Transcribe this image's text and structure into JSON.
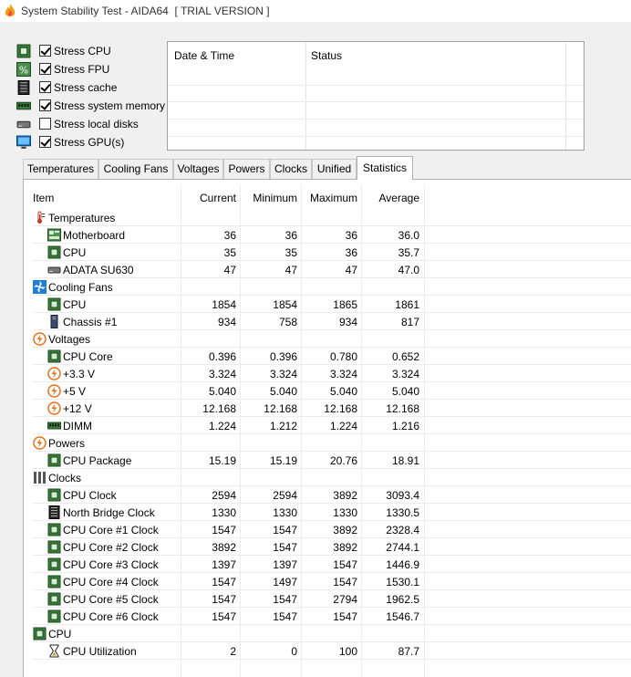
{
  "window": {
    "title": "System Stability Test - AIDA64  [ TRIAL VERSION ]"
  },
  "stress_options": [
    {
      "label": "Stress CPU",
      "checked": true,
      "icon": "cpu-chip-icon"
    },
    {
      "label": "Stress FPU",
      "checked": true,
      "icon": "fpu-icon"
    },
    {
      "label": "Stress cache",
      "checked": true,
      "icon": "cache-icon"
    },
    {
      "label": "Stress system memory",
      "checked": true,
      "icon": "memory-icon"
    },
    {
      "label": "Stress local disks",
      "checked": false,
      "icon": "disk-icon"
    },
    {
      "label": "Stress GPU(s)",
      "checked": true,
      "icon": "monitor-icon"
    }
  ],
  "log": {
    "col_datetime": "Date & Time",
    "col_status": "Status"
  },
  "tabs": [
    "Temperatures",
    "Cooling Fans",
    "Voltages",
    "Powers",
    "Clocks",
    "Unified",
    "Statistics"
  ],
  "active_tab": "Statistics",
  "stats": {
    "headers": {
      "item": "Item",
      "current": "Current",
      "minimum": "Minimum",
      "maximum": "Maximum",
      "average": "Average"
    },
    "rows": [
      {
        "type": "group",
        "name": "Temperatures",
        "icon": "thermometer-icon"
      },
      {
        "type": "item",
        "name": "Motherboard",
        "icon": "motherboard-icon",
        "current": "36",
        "minimum": "36",
        "maximum": "36",
        "average": "36.0"
      },
      {
        "type": "item",
        "name": "CPU",
        "icon": "cpu-chip-icon",
        "current": "35",
        "minimum": "35",
        "maximum": "36",
        "average": "35.7"
      },
      {
        "type": "item",
        "name": "ADATA SU630",
        "icon": "disk-icon",
        "current": "47",
        "minimum": "47",
        "maximum": "47",
        "average": "47.0"
      },
      {
        "type": "group",
        "name": "Cooling Fans",
        "icon": "fan-icon"
      },
      {
        "type": "item",
        "name": "CPU",
        "icon": "cpu-chip-icon",
        "current": "1854",
        "minimum": "1854",
        "maximum": "1865",
        "average": "1861"
      },
      {
        "type": "item",
        "name": "Chassis #1",
        "icon": "chassis-icon",
        "current": "934",
        "minimum": "758",
        "maximum": "934",
        "average": "817"
      },
      {
        "type": "group",
        "name": "Voltages",
        "icon": "lightning-icon"
      },
      {
        "type": "item",
        "name": "CPU Core",
        "icon": "cpu-chip-icon",
        "current": "0.396",
        "minimum": "0.396",
        "maximum": "0.780",
        "average": "0.652"
      },
      {
        "type": "item",
        "name": "+3.3 V",
        "icon": "lightning-icon",
        "current": "3.324",
        "minimum": "3.324",
        "maximum": "3.324",
        "average": "3.324"
      },
      {
        "type": "item",
        "name": "+5 V",
        "icon": "lightning-icon",
        "current": "5.040",
        "minimum": "5.040",
        "maximum": "5.040",
        "average": "5.040"
      },
      {
        "type": "item",
        "name": "+12 V",
        "icon": "lightning-icon",
        "current": "12.168",
        "minimum": "12.168",
        "maximum": "12.168",
        "average": "12.168"
      },
      {
        "type": "item",
        "name": "DIMM",
        "icon": "memory-icon",
        "current": "1.224",
        "minimum": "1.212",
        "maximum": "1.224",
        "average": "1.216"
      },
      {
        "type": "group",
        "name": "Powers",
        "icon": "lightning-icon"
      },
      {
        "type": "item",
        "name": "CPU Package",
        "icon": "cpu-chip-icon",
        "current": "15.19",
        "minimum": "15.19",
        "maximum": "20.76",
        "average": "18.91"
      },
      {
        "type": "group",
        "name": "Clocks",
        "icon": "clock-bars-icon"
      },
      {
        "type": "item",
        "name": "CPU Clock",
        "icon": "cpu-chip-icon",
        "current": "2594",
        "minimum": "2594",
        "maximum": "3892",
        "average": "3093.4"
      },
      {
        "type": "item",
        "name": "North Bridge Clock",
        "icon": "cache-icon",
        "current": "1330",
        "minimum": "1330",
        "maximum": "1330",
        "average": "1330.5"
      },
      {
        "type": "item",
        "name": "CPU Core #1 Clock",
        "icon": "cpu-chip-icon",
        "current": "1547",
        "minimum": "1547",
        "maximum": "3892",
        "average": "2328.4"
      },
      {
        "type": "item",
        "name": "CPU Core #2 Clock",
        "icon": "cpu-chip-icon",
        "current": "3892",
        "minimum": "1547",
        "maximum": "3892",
        "average": "2744.1"
      },
      {
        "type": "item",
        "name": "CPU Core #3 Clock",
        "icon": "cpu-chip-icon",
        "current": "1397",
        "minimum": "1397",
        "maximum": "1547",
        "average": "1446.9"
      },
      {
        "type": "item",
        "name": "CPU Core #4 Clock",
        "icon": "cpu-chip-icon",
        "current": "1547",
        "minimum": "1497",
        "maximum": "1547",
        "average": "1530.1"
      },
      {
        "type": "item",
        "name": "CPU Core #5 Clock",
        "icon": "cpu-chip-icon",
        "current": "1547",
        "minimum": "1547",
        "maximum": "2794",
        "average": "1962.5"
      },
      {
        "type": "item",
        "name": "CPU Core #6 Clock",
        "icon": "cpu-chip-icon",
        "current": "1547",
        "minimum": "1547",
        "maximum": "1547",
        "average": "1546.7"
      },
      {
        "type": "group",
        "name": "CPU",
        "icon": "cpu-chip-icon"
      },
      {
        "type": "item",
        "name": "CPU Utilization",
        "icon": "hourglass-icon",
        "current": "2",
        "minimum": "0",
        "maximum": "100",
        "average": "87.7"
      }
    ]
  },
  "colors": {
    "tab_bg": "#f0f0f0",
    "chip_green": "#3a7d3a",
    "lightning_orange": "#e8701a",
    "fan_blue": "#1e7fd6"
  }
}
